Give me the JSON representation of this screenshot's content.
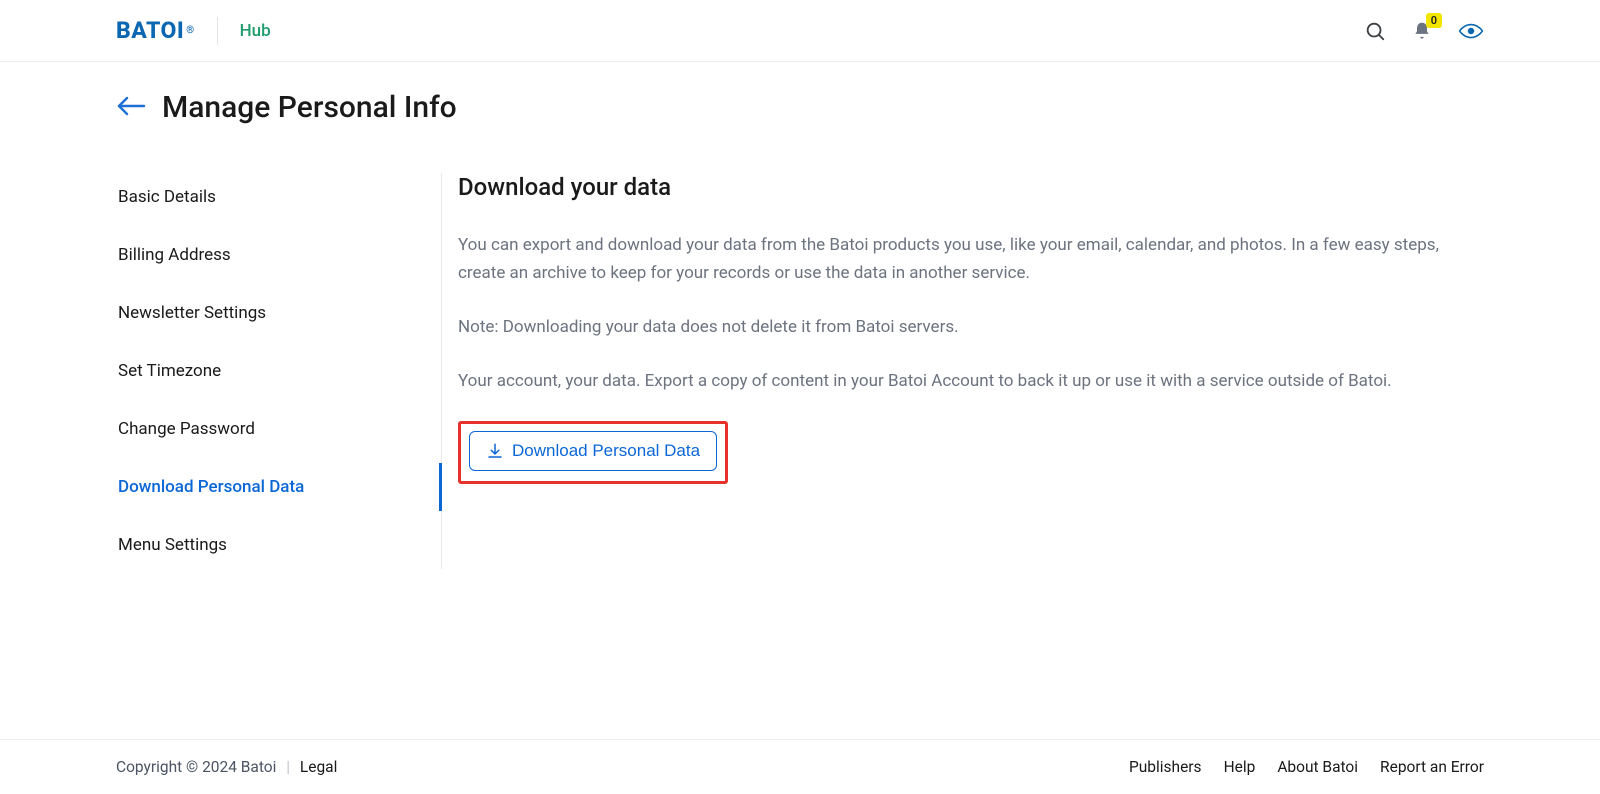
{
  "brand": {
    "logo_text": "BATOI",
    "reg": "®",
    "hub": "Hub"
  },
  "notifications": {
    "count": "0"
  },
  "page": {
    "title": "Manage Personal Info"
  },
  "sidebar": {
    "items": [
      {
        "label": "Basic Details"
      },
      {
        "label": "Billing Address"
      },
      {
        "label": "Newsletter Settings"
      },
      {
        "label": "Set Timezone"
      },
      {
        "label": "Change Password"
      },
      {
        "label": "Download Personal Data"
      },
      {
        "label": "Menu Settings"
      }
    ],
    "active_index": 5
  },
  "content": {
    "heading": "Download your data",
    "para1": "You can export and download your data from the Batoi products you use, like your email, calendar, and photos. In a few easy steps, create an archive to keep for your records or use the data in another service.",
    "para2": "Note: Downloading your data does not delete it from Batoi servers.",
    "para3": "Your account, your data. Export a copy of content in your Batoi Account to back it up or use it with a service outside of Batoi.",
    "button_label": "Download Personal Data"
  },
  "footer": {
    "copyright": "Copyright © 2024 Batoi",
    "legal": "Legal",
    "links": [
      {
        "label": "Publishers"
      },
      {
        "label": "Help"
      },
      {
        "label": "About Batoi"
      },
      {
        "label": "Report an Error"
      }
    ]
  }
}
